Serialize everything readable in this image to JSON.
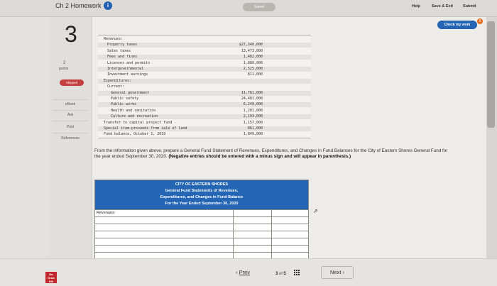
{
  "header": {
    "title": "Ch 2 Homework",
    "saved": "Saved",
    "help": "Help",
    "save_exit": "Save & Exit",
    "submit": "Submit",
    "check_work": "Check my work",
    "check_badge": "6"
  },
  "sidebar": {
    "question_number": "3",
    "points_value": "2",
    "points_label": "points",
    "status": "Skipped",
    "items": [
      {
        "label": "eBook"
      },
      {
        "label": "Ask"
      },
      {
        "label": "Print"
      },
      {
        "label": "References"
      }
    ]
  },
  "data_table": {
    "rows": [
      {
        "label": "Revenues:",
        "value": "",
        "indent": 0
      },
      {
        "label": "Property taxes",
        "value": "$27,340,000",
        "indent": 1
      },
      {
        "label": "Sales taxes",
        "value": "13,473,000",
        "indent": 1
      },
      {
        "label": "Fees and fines",
        "value": "1,482,000",
        "indent": 1
      },
      {
        "label": "Licenses and permits",
        "value": "1,880,000",
        "indent": 1
      },
      {
        "label": "Intergovernmental",
        "value": "2,525,000",
        "indent": 1
      },
      {
        "label": "Investment earnings",
        "value": "811,000",
        "indent": 1
      },
      {
        "label": "Expenditures:",
        "value": "",
        "indent": 0
      },
      {
        "label": "Current:",
        "value": "",
        "indent": 1
      },
      {
        "label": "General government",
        "value": "11,761,000",
        "indent": 2
      },
      {
        "label": "Public safety",
        "value": "24,481,000",
        "indent": 2
      },
      {
        "label": "Public works",
        "value": "6,249,000",
        "indent": 2
      },
      {
        "label": "Health and sanitation",
        "value": "1,281,000",
        "indent": 2
      },
      {
        "label": "Culture and recreation",
        "value": "2,193,000",
        "indent": 2
      },
      {
        "label": "Transfer to capital project fund",
        "value": "1,157,000",
        "indent": 0
      },
      {
        "label": "Special item-proceeds from sale of land",
        "value": "861,000",
        "indent": 0
      },
      {
        "label": "Fund balance, October 1, 2019",
        "value": "1,849,000",
        "indent": 0
      }
    ]
  },
  "instructions": {
    "text": "From the information given above, prepare a General Fund Statement of Revenues, Expenditures, and Changes in Fund Balances for the City of Eastern Shores General Fund for the year ended September 30, 2020.",
    "bold": "(Negative entries should be entered with a minus sign and will appear in parenthesis.)"
  },
  "answer_table": {
    "header_lines": [
      "CITY OF EASTERN SHORES",
      "General Fund Statements of Revenues,",
      "Expenditures, and Changes in Fund Balance",
      "For the Year Ended September 30, 2020"
    ],
    "rows": [
      "Revenues:",
      "",
      "",
      "",
      "",
      "",
      ""
    ]
  },
  "footer": {
    "prev": "Prev",
    "page_current": "3",
    "page_of": "of",
    "page_total": "5",
    "next": "Next",
    "logo_text": "Mc Graw Hill"
  }
}
